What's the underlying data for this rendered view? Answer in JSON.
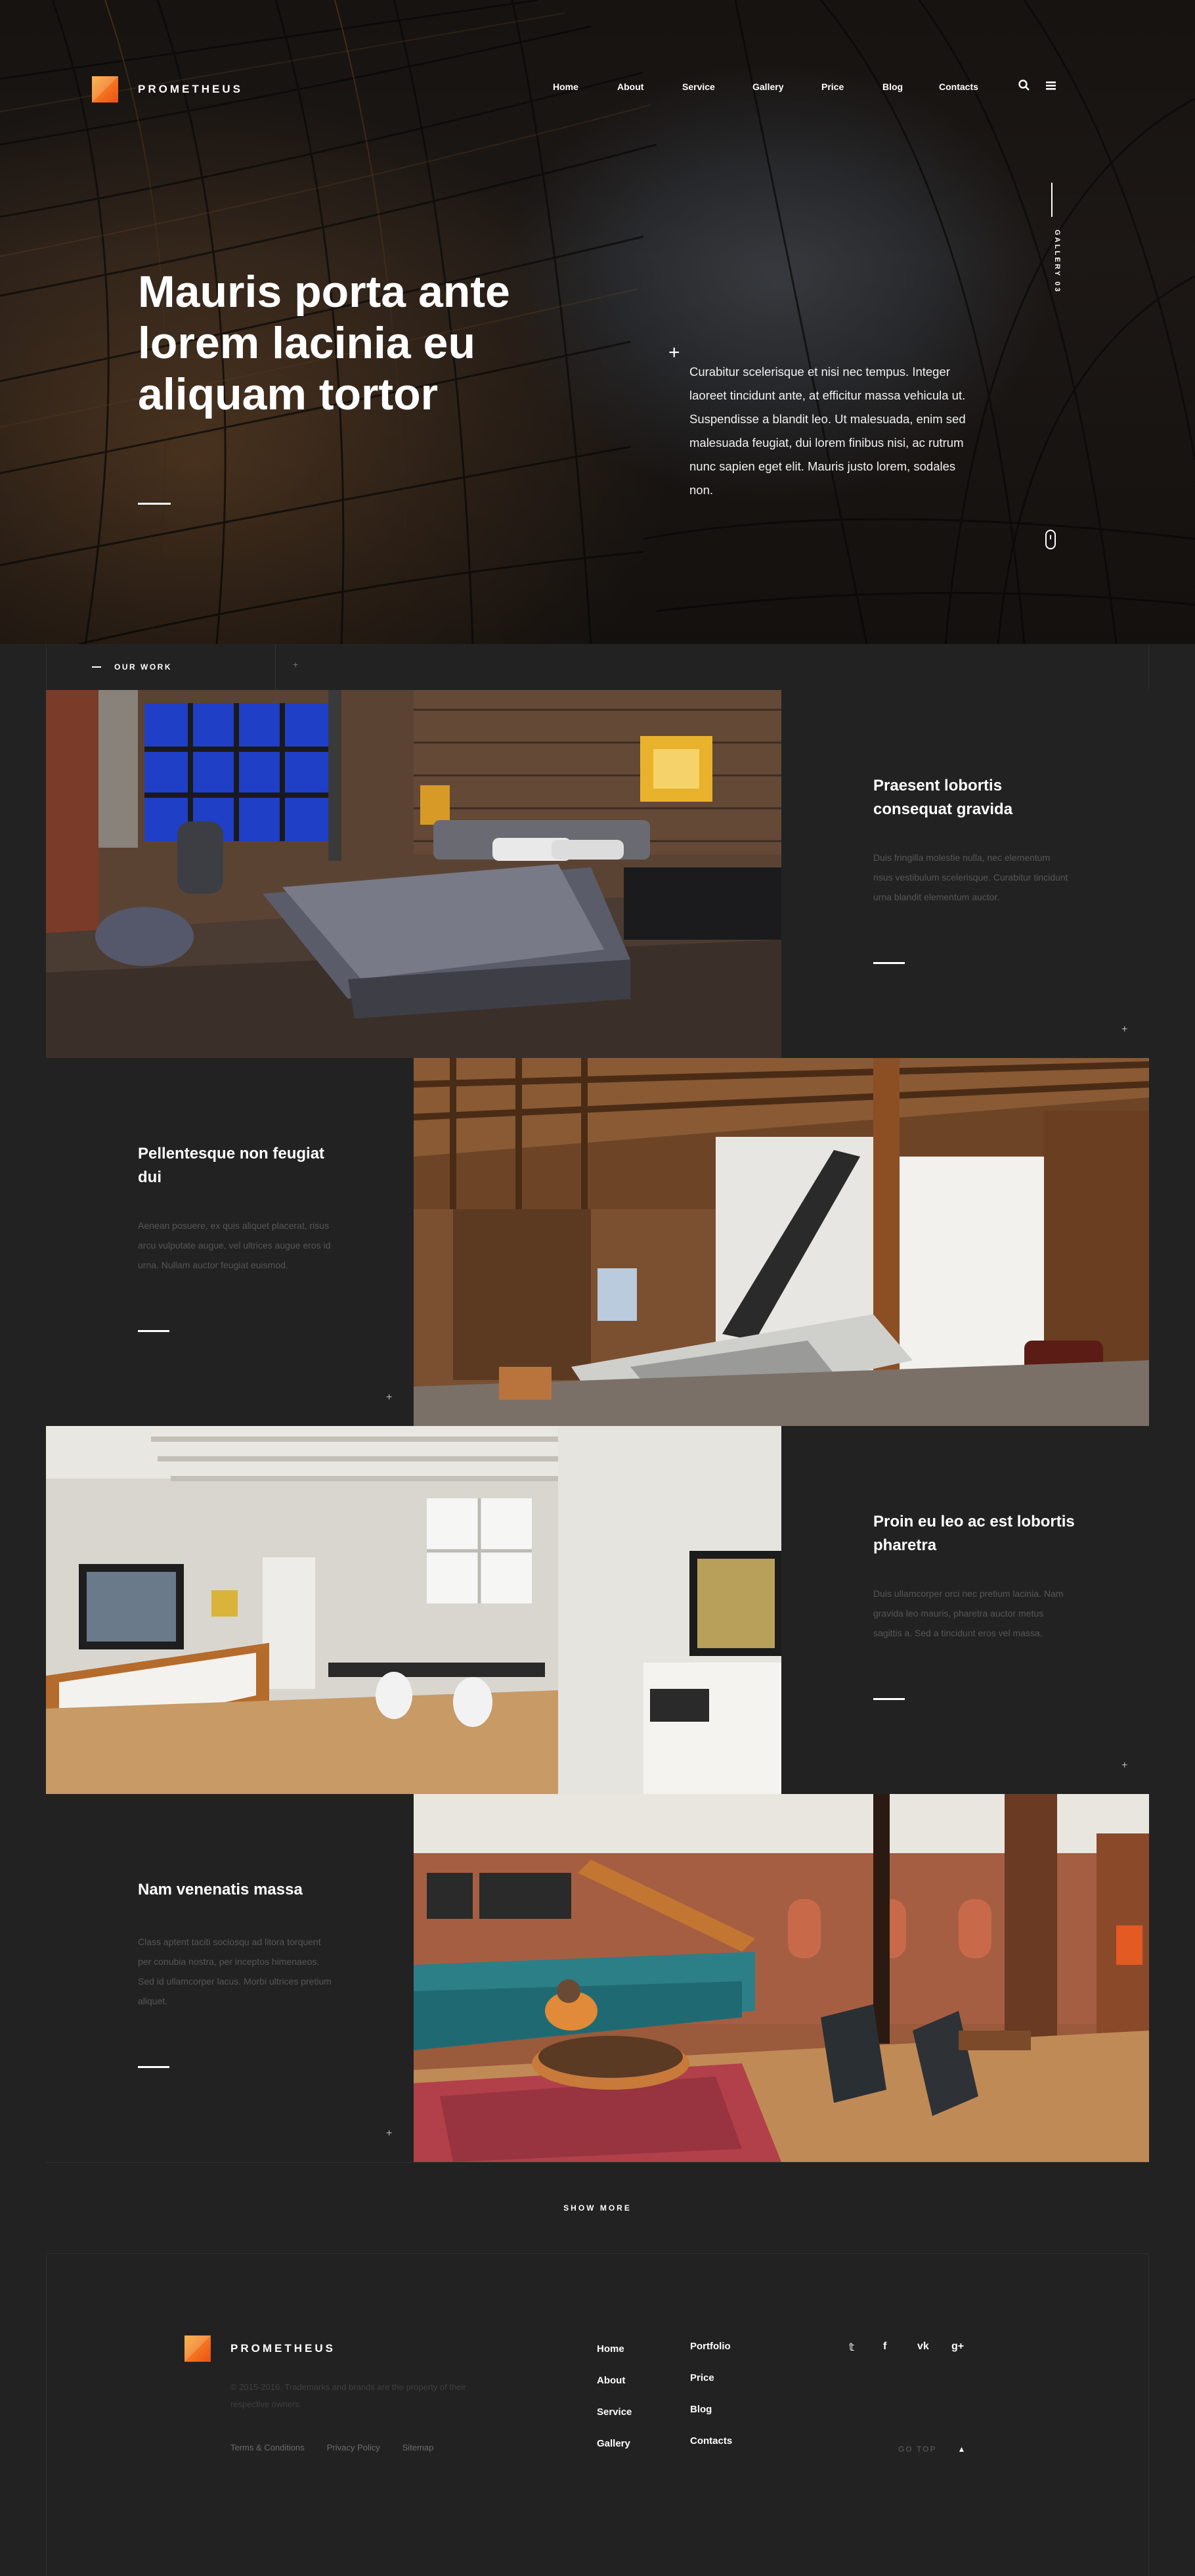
{
  "brand": {
    "name": "PROMETHEUS",
    "accent": "#f7851f"
  },
  "nav": {
    "items": [
      "Home",
      "About",
      "Service",
      "Gallery",
      "Price",
      "Blog",
      "Contacts"
    ],
    "icons": [
      "search-icon",
      "menu-icon"
    ]
  },
  "hero": {
    "title": "Mauris porta ante\nlorem lacinia  eu\naliquam tortor",
    "plus": "+",
    "text": "Curabitur scelerisque et nisi nec tempus. Integer laoreet tincidunt ante, at efficitur massa vehicula ut. Suspendisse a blandit leo. Ut malesuada, enim sed malesuada feugiat, dui lorem finibus nisi, ac rutrum nunc sapien eget elit. Mauris justo lorem, sodales non.",
    "gallery_label": "GALLERY 03"
  },
  "work": {
    "section_label": "OUR WORK",
    "plus": "+",
    "items": [
      {
        "title": "Praesent lobortis consequat gravida",
        "desc": "Duis fringilla molestie nulla, nec elementum risus vestibulum scelerisque. Curabitur tincidunt urna blandit elementum auctor.",
        "plus": "+",
        "image": "loft-bedroom"
      },
      {
        "title": "Pellentesque non feugiat dui",
        "desc": "Aenean posuere, ex quis aliquet placerat, risus arcu vulputate augue, vel ultrices augue eros id urna. Nullam auctor feugiat euismod.",
        "plus": "+",
        "image": "wooden-loft-kitchen"
      },
      {
        "title": "Proin eu leo ac est lobortis pharetra",
        "desc": "Duis ullamcorper orci nec pretium lacinia. Nam gravida leo mauris, pharetra auctor metus sagittis a. Sed a tincidunt eros vel massa.",
        "plus": "+",
        "image": "white-dining-room"
      },
      {
        "title": "Nam venenatis massa",
        "desc": "Class aptent taciti sociosqu ad litora torquent per conubia nostra, per inceptos himenaeos. Sed id ullamcorper lacus. Morbi ultrices pretium aliquet.",
        "plus": "+",
        "image": "brick-loft-living-room"
      }
    ],
    "show_more": "SHOW MORE"
  },
  "footer": {
    "copyright": "© 2015-2016. Trademarks and brands are the property of their respective owners.",
    "links": [
      "Terms & Conditions",
      "Privacy Policy",
      "Sitemap"
    ],
    "col1": [
      "Home",
      "About",
      "Service",
      "Gallery"
    ],
    "col2": [
      "Portfolio",
      "Price",
      "Blog",
      "Contacts"
    ],
    "social": [
      "twitter-icon",
      "facebook-icon",
      "vk-icon",
      "google-plus-icon"
    ],
    "social_glyphs": [
      "𝕥",
      "f",
      "vk",
      "g+"
    ],
    "go_top": "GO TOP",
    "go_top_arrow": "▲"
  }
}
